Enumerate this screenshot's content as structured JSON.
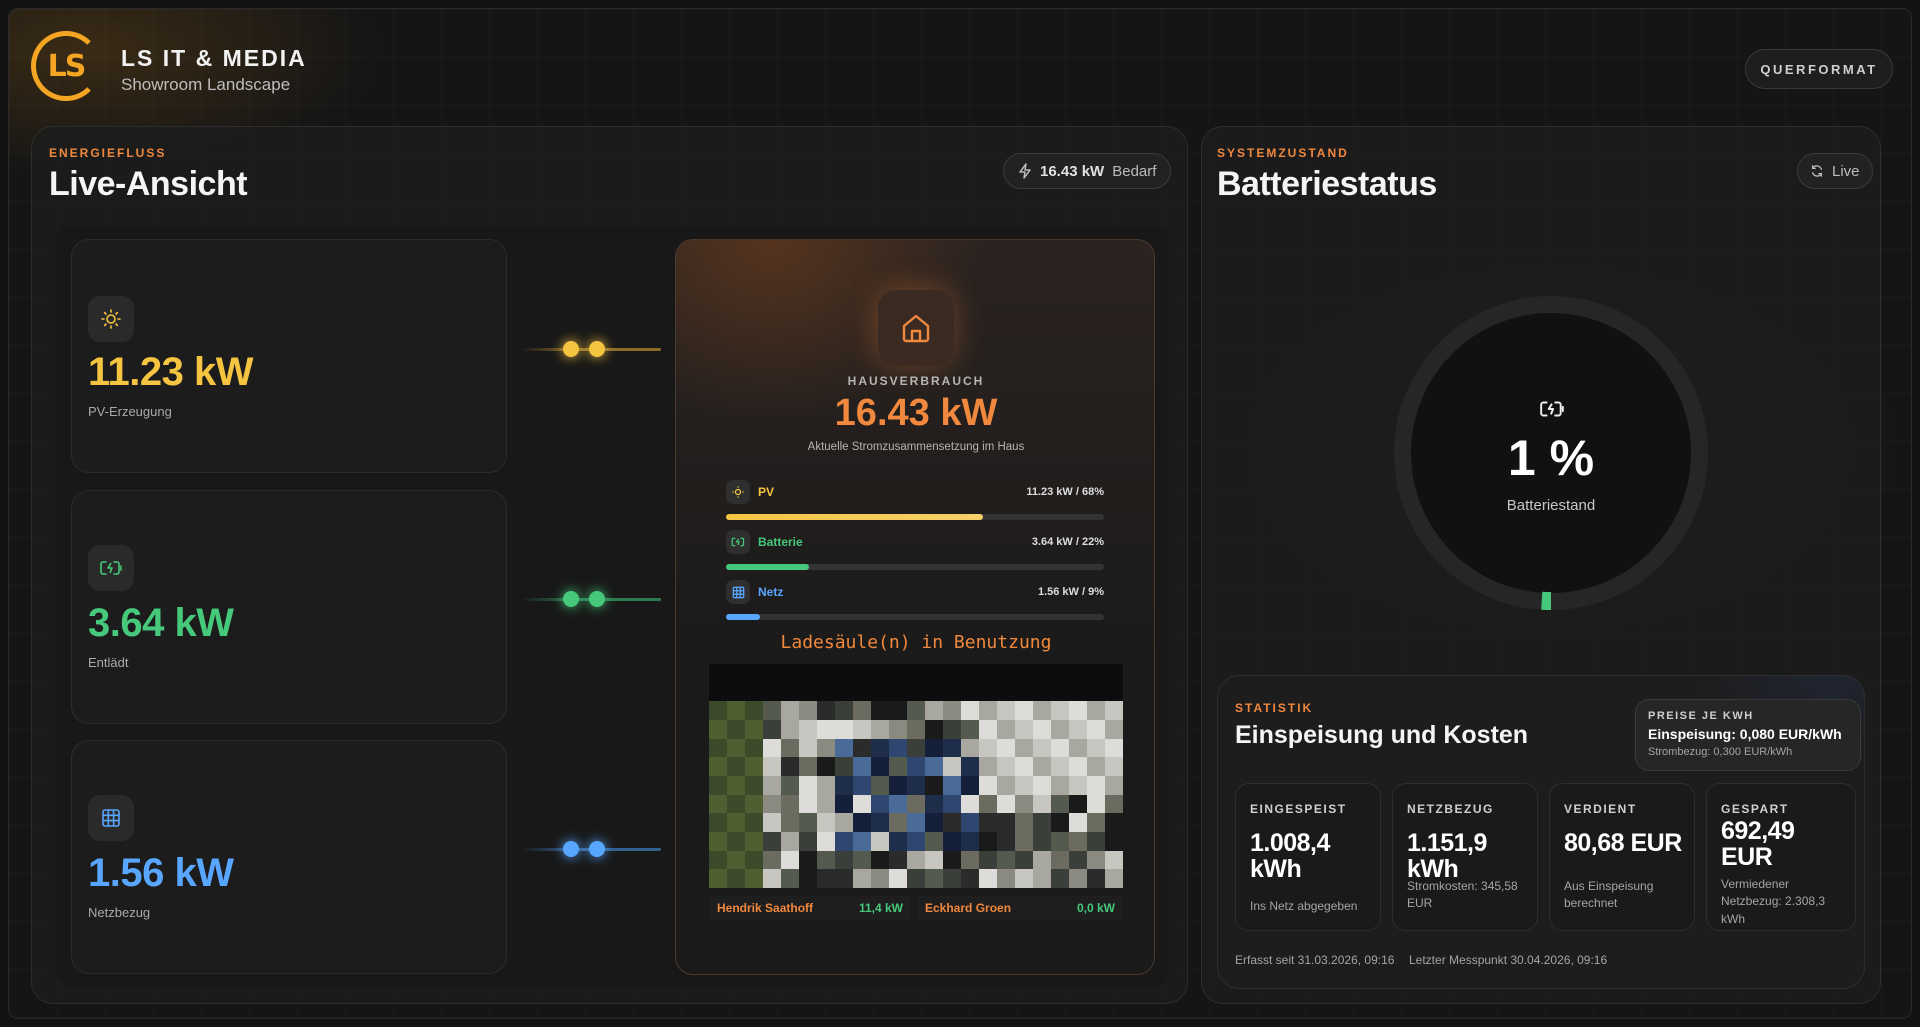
{
  "header": {
    "logo_text": "LS",
    "brand": "LS IT & MEDIA",
    "subtitle": "Showroom Landscape",
    "orientation_button": "QUERFORMAT"
  },
  "energy": {
    "eyebrow": "ENERGIEFLUSS",
    "title": "Live-Ansicht",
    "demand_value": "16.43 kW",
    "demand_label": "Bedarf",
    "sources": [
      {
        "value": "11.23 kW",
        "label": "PV-Erzeugung",
        "icon": "sun-icon",
        "color": "#f5c542"
      },
      {
        "value": "3.64 kW",
        "label": "Entlädt",
        "icon": "battery-charging-icon",
        "color": "#46c97a"
      },
      {
        "value": "1.56 kW",
        "label": "Netzbezug",
        "icon": "grid-icon",
        "color": "#58a6ff"
      }
    ]
  },
  "house": {
    "icon": "home-icon",
    "label": "HAUSVERBRAUCH",
    "value": "16.43 kW",
    "desc": "Aktuelle Stromzusammensetzung im Haus",
    "mix": [
      {
        "name": "PV",
        "value": "11.23 kW / 68%",
        "share": 0.68,
        "color": "#f5c542",
        "icon": "sun-icon"
      },
      {
        "name": "Batterie",
        "value": "3.64 kW / 22%",
        "share": 0.22,
        "color": "#46c97a",
        "icon": "battery-charging-icon"
      },
      {
        "name": "Netz",
        "value": "1.56 kW / 9%",
        "share": 0.09,
        "color": "#58a6ff",
        "icon": "grid-icon"
      }
    ],
    "charging_title": "Ladesäule(n) in Benutzung",
    "chargers": [
      {
        "name": "Hendrik Saathoff",
        "power": "11,4 kW"
      },
      {
        "name": "Eckhard Groen",
        "power": "0,0 kW"
      }
    ]
  },
  "battery": {
    "eyebrow": "SYSTEMZUSTAND",
    "title": "Batteriestatus",
    "live_label": "Live",
    "percent_text": "1 %",
    "level": 0.01,
    "state_label": "Batteriestand"
  },
  "stats": {
    "eyebrow": "STATISTIK",
    "title": "Einspeisung und Kosten",
    "price_label": "PREISE JE KWH",
    "price_feed": "Einspeisung: 0,080 EUR/kWh",
    "price_draw": "Strombezug: 0,300 EUR/kWh",
    "cards": [
      {
        "label": "EINGESPEIST",
        "value": "1.008,4 kWh",
        "desc": "Ins Netz abgegeben"
      },
      {
        "label": "NETZBEZUG",
        "value": "1.151,9 kWh",
        "desc": "Stromkosten: 345,58 EUR"
      },
      {
        "label": "VERDIENT",
        "value": "80,68 EUR",
        "desc": "Aus Einspeisung berechnet"
      },
      {
        "label": "GESPART",
        "value": "692,49 EUR",
        "desc": "Vermiedener Netzbezug: 2.308,3 kWh"
      }
    ],
    "since": "Erfasst seit 31.03.2026, 09:16",
    "last": "Letzter Messpunkt 30.04.2026, 09:16"
  },
  "colors": {
    "accent": "#f0883e",
    "brand": "#f5a524",
    "pv": "#f5c542",
    "battery": "#46c97a",
    "grid": "#58a6ff"
  }
}
